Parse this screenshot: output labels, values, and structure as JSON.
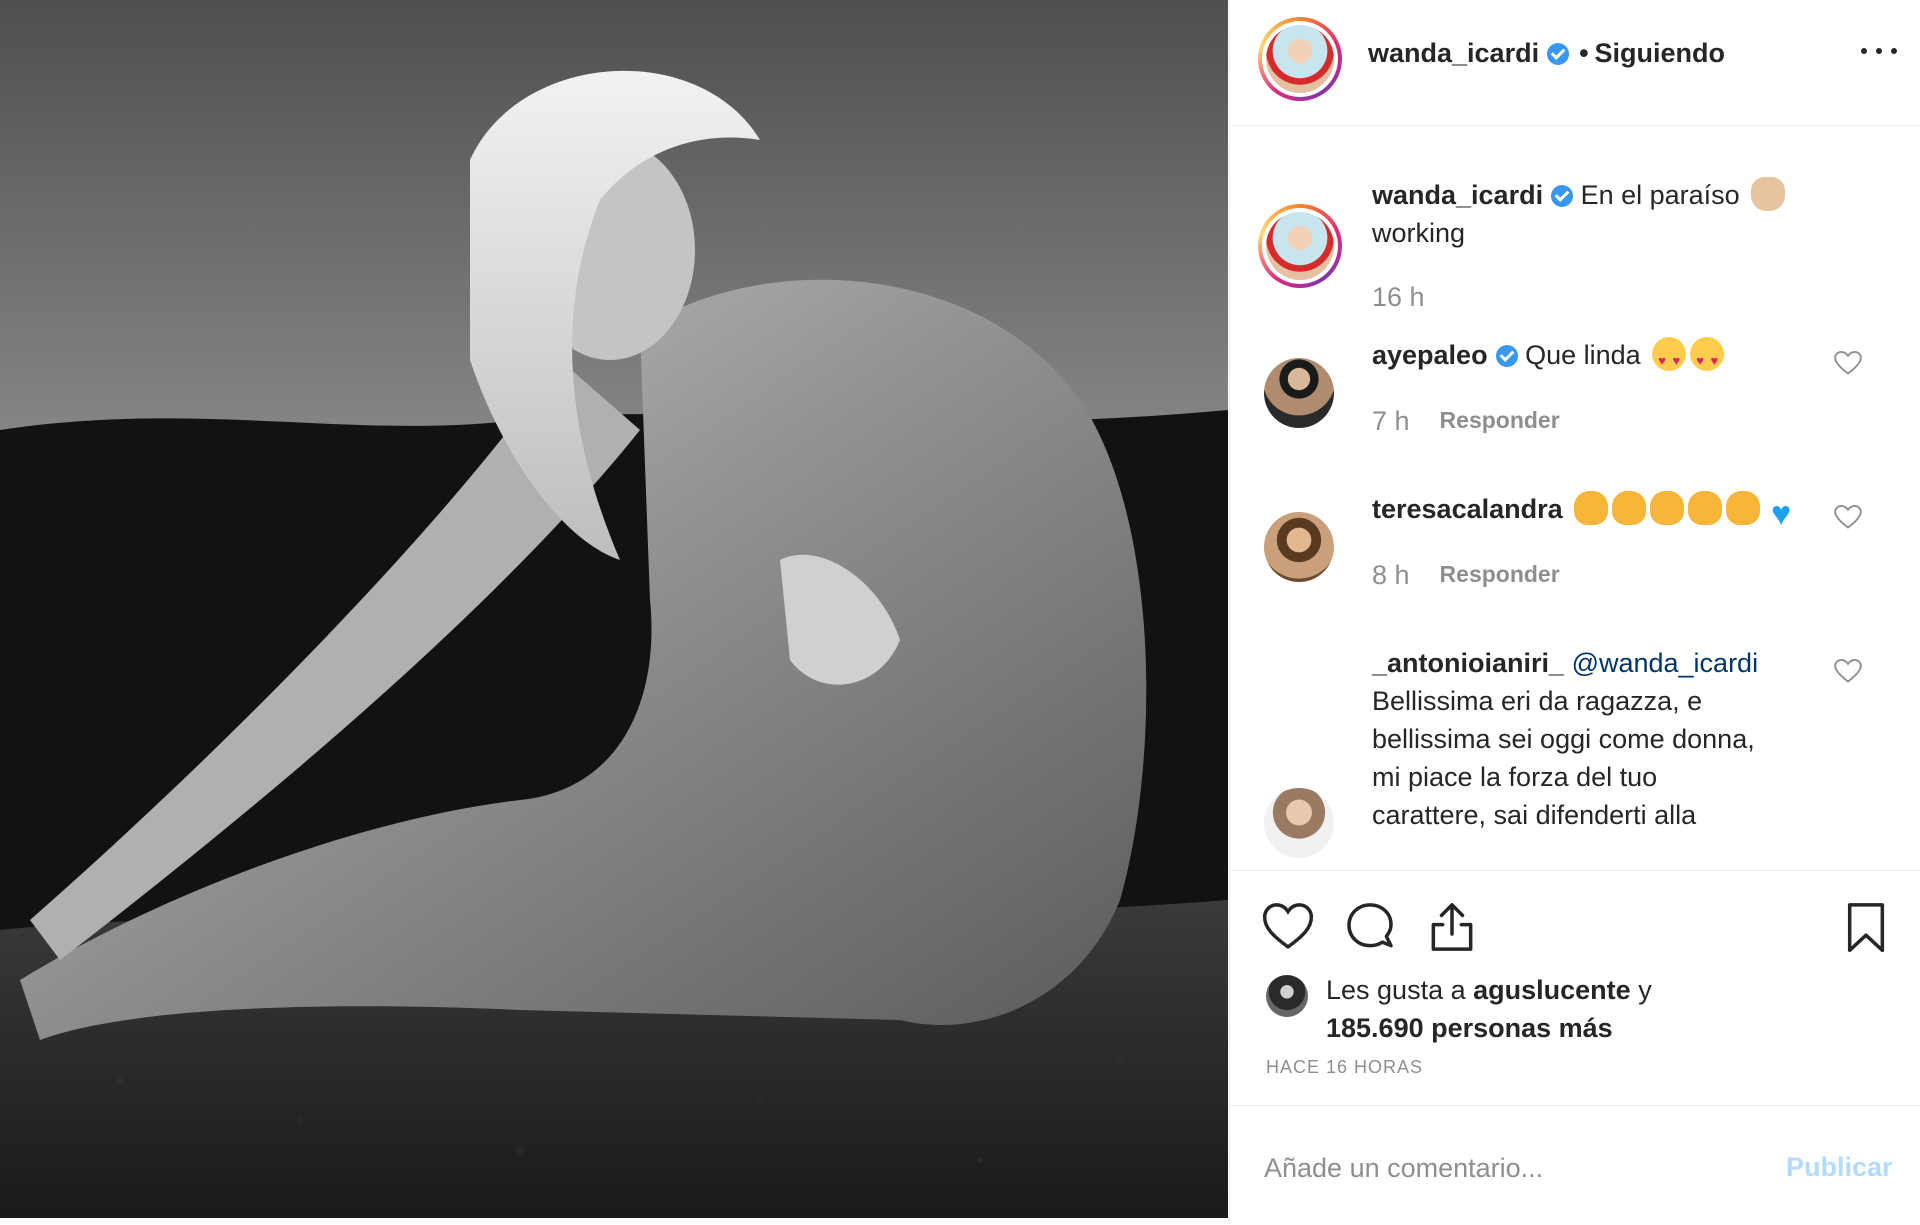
{
  "post": {
    "photo_alt": "Black and white photo",
    "header": {
      "username": "wanda_icardi",
      "separator": "•",
      "follow_status": "Siguiendo"
    },
    "caption": {
      "username": "wanda_icardi",
      "text_line1": "En el paraíso",
      "text_line2": "working",
      "time": "16 h"
    },
    "comments": [
      {
        "username": "ayepaleo",
        "verified": true,
        "text": "Que linda",
        "emoji": [
          "heart-eyes-emoji",
          "heart-eyes-emoji"
        ],
        "time": "7 h",
        "reply_label": "Responder"
      },
      {
        "username": "teresacalandra",
        "verified": false,
        "text": "",
        "emoji": [
          "clap-emoji",
          "clap-emoji",
          "clap-emoji",
          "clap-emoji",
          "clap-emoji",
          "blue-heart-emoji"
        ],
        "time": "8 h",
        "reply_label": "Responder"
      },
      {
        "username": "_antonioianiri_",
        "verified": false,
        "mention": "@wanda_icardi",
        "lines": [
          "Bellissima eri da ragazza, e",
          "bellissima sei oggi come donna,",
          "mi piace la forza del tuo",
          "carattere, sai difenderti alla"
        ]
      }
    ],
    "likes": {
      "prefix": "Les gusta a",
      "first_user": "aguslucente",
      "joiner": "y",
      "others": "185.690 personas más"
    },
    "timestamp": "HACE 16 HORAS",
    "add_comment": {
      "placeholder": "Añade un comentario...",
      "publish_label": "Publicar"
    },
    "icons": [
      "more-options-icon",
      "verified-badge-icon",
      "heart-icon",
      "comment-icon",
      "share-icon",
      "bookmark-icon"
    ],
    "colors": {
      "verified_blue": "#3897f0",
      "publish_disabled": "#b3dbff",
      "secondary_text": "#8e8e8e",
      "primary_text": "#262626"
    }
  }
}
